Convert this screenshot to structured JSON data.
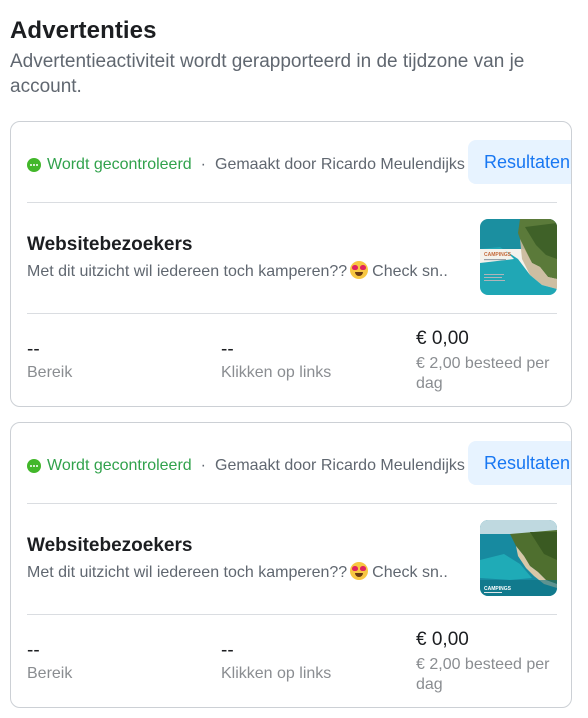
{
  "page": {
    "title": "Advertenties",
    "subtitle": "Advertentieactiviteit wordt gerapporteerd in de tijdzone van je account."
  },
  "ads": [
    {
      "status": "Wordt gecontroleerd",
      "creator": "Gemaakt door Ricardo Meulendijks",
      "results_button": "Resultaten",
      "name": "Websitebezoekers",
      "body_before": "Met dit uitzicht wil iedereen toch kamperen??",
      "body_after": "Check sn...",
      "emoji": "heart-eyes-emoji",
      "reach_value": "--",
      "reach_label": "Bereik",
      "clicks_value": "--",
      "clicks_label": "Klikken op links",
      "spend_value": "€ 0,00",
      "spend_label": "€ 2,00 besteed per dag",
      "thumbnail_caption": "CAMPINGS"
    },
    {
      "status": "Wordt gecontroleerd",
      "creator": "Gemaakt door Ricardo Meulendijks",
      "results_button": "Resultaten",
      "name": "Websitebezoekers",
      "body_before": "Met dit uitzicht wil iedereen toch kamperen??",
      "body_after": "Check sn...",
      "emoji": "heart-eyes-emoji",
      "reach_value": "--",
      "reach_label": "Bereik",
      "clicks_value": "--",
      "clicks_label": "Klikken op links",
      "spend_value": "€ 0,00",
      "spend_label": "€ 2,00 besteed per dag",
      "thumbnail_caption": "CAMPINGS"
    }
  ],
  "colors": {
    "status_green": "#31a24c",
    "accent_blue": "#1877f2",
    "button_bg": "#e7f3ff",
    "muted_text": "#606770"
  }
}
